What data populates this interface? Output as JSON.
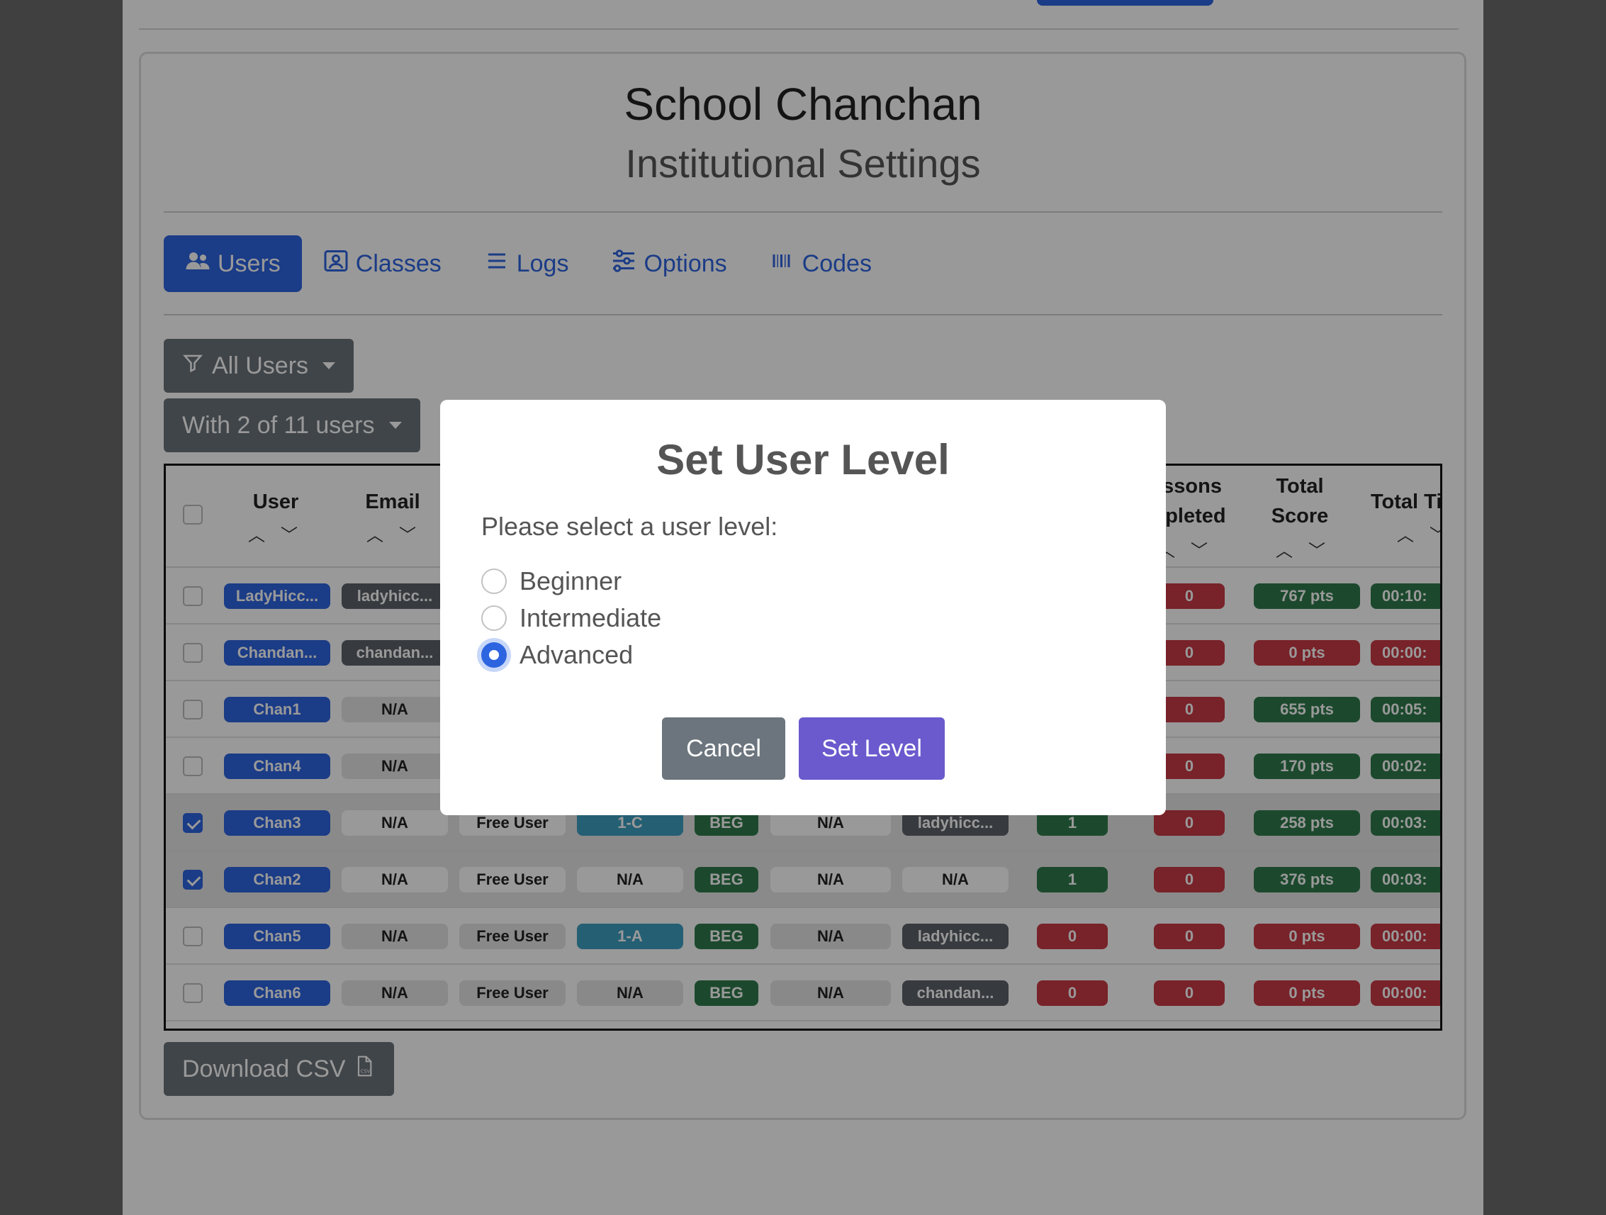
{
  "header": {
    "school_name": "School Chanchan",
    "subtitle": "Institutional Settings"
  },
  "tabs": [
    {
      "label": "Users",
      "icon": "users-icon",
      "active": true
    },
    {
      "label": "Classes",
      "icon": "classes-icon",
      "active": false
    },
    {
      "label": "Logs",
      "icon": "list-icon",
      "active": false
    },
    {
      "label": "Options",
      "icon": "sliders-icon",
      "active": false
    },
    {
      "label": "Codes",
      "icon": "barcode-icon",
      "active": false
    }
  ],
  "filters": {
    "filter_label": "All Users",
    "action_label": "With 2 of 11 users"
  },
  "table": {
    "columns": {
      "user": "User",
      "email": "Email",
      "lessons_line1": "essons",
      "lessons_line2": "mpleted",
      "score_line1": "Total",
      "score_line2": "Score",
      "time": "Total Ti"
    },
    "rows": [
      {
        "user": "LadyHicc...",
        "email": "ladyhicc...",
        "lessons": "0",
        "score": "767 pts",
        "time": "00:10:",
        "selected": false
      },
      {
        "user": "Chandan...",
        "email": "chandan...",
        "lessons": "0",
        "score": "0 pts",
        "time": "00:00:",
        "selected": false
      },
      {
        "user": "Chan1",
        "email": "N/A",
        "lessons": "0",
        "score": "655 pts",
        "time": "00:05:",
        "selected": false
      },
      {
        "user": "Chan4",
        "email": "N/A",
        "lessons": "0",
        "score": "170 pts",
        "time": "00:02:",
        "selected": false
      },
      {
        "user": "Chan3",
        "email": "N/A",
        "type": "Free User",
        "class": "1-C",
        "level": "BEG",
        "col6": "N/A",
        "col7": "ladyhicc...",
        "col8": "1",
        "lessons": "0",
        "score": "258 pts",
        "time": "00:03:",
        "selected": true
      },
      {
        "user": "Chan2",
        "email": "N/A",
        "type": "Free User",
        "class": "N/A",
        "level": "BEG",
        "col6": "N/A",
        "col7": "N/A",
        "col8": "1",
        "lessons": "0",
        "score": "376 pts",
        "time": "00:03:",
        "selected": true
      },
      {
        "user": "Chan5",
        "email": "N/A",
        "type": "Free User",
        "class": "1-A",
        "level": "BEG",
        "col6": "N/A",
        "col7": "ladyhicc...",
        "col8": "0",
        "lessons": "0",
        "score": "0 pts",
        "time": "00:00:",
        "selected": false
      },
      {
        "user": "Chan6",
        "email": "N/A",
        "type": "Free User",
        "class": "N/A",
        "level": "BEG",
        "col6": "N/A",
        "col7": "chandan...",
        "col8": "0",
        "lessons": "0",
        "score": "0 pts",
        "time": "00:00:",
        "selected": false
      }
    ]
  },
  "download_label": "Download CSV",
  "modal": {
    "title": "Set User Level",
    "prompt": "Please select a user level:",
    "options": [
      {
        "label": "Beginner",
        "selected": false
      },
      {
        "label": "Intermediate",
        "selected": false
      },
      {
        "label": "Advanced",
        "selected": true
      }
    ],
    "cancel_label": "Cancel",
    "confirm_label": "Set Level"
  },
  "colors": {
    "primary": "#2d64e0",
    "secondary": "#6c737b",
    "success": "#2f7a4c",
    "danger": "#c83a45",
    "info": "#3f9fc2",
    "confirm": "#6a5acd"
  }
}
